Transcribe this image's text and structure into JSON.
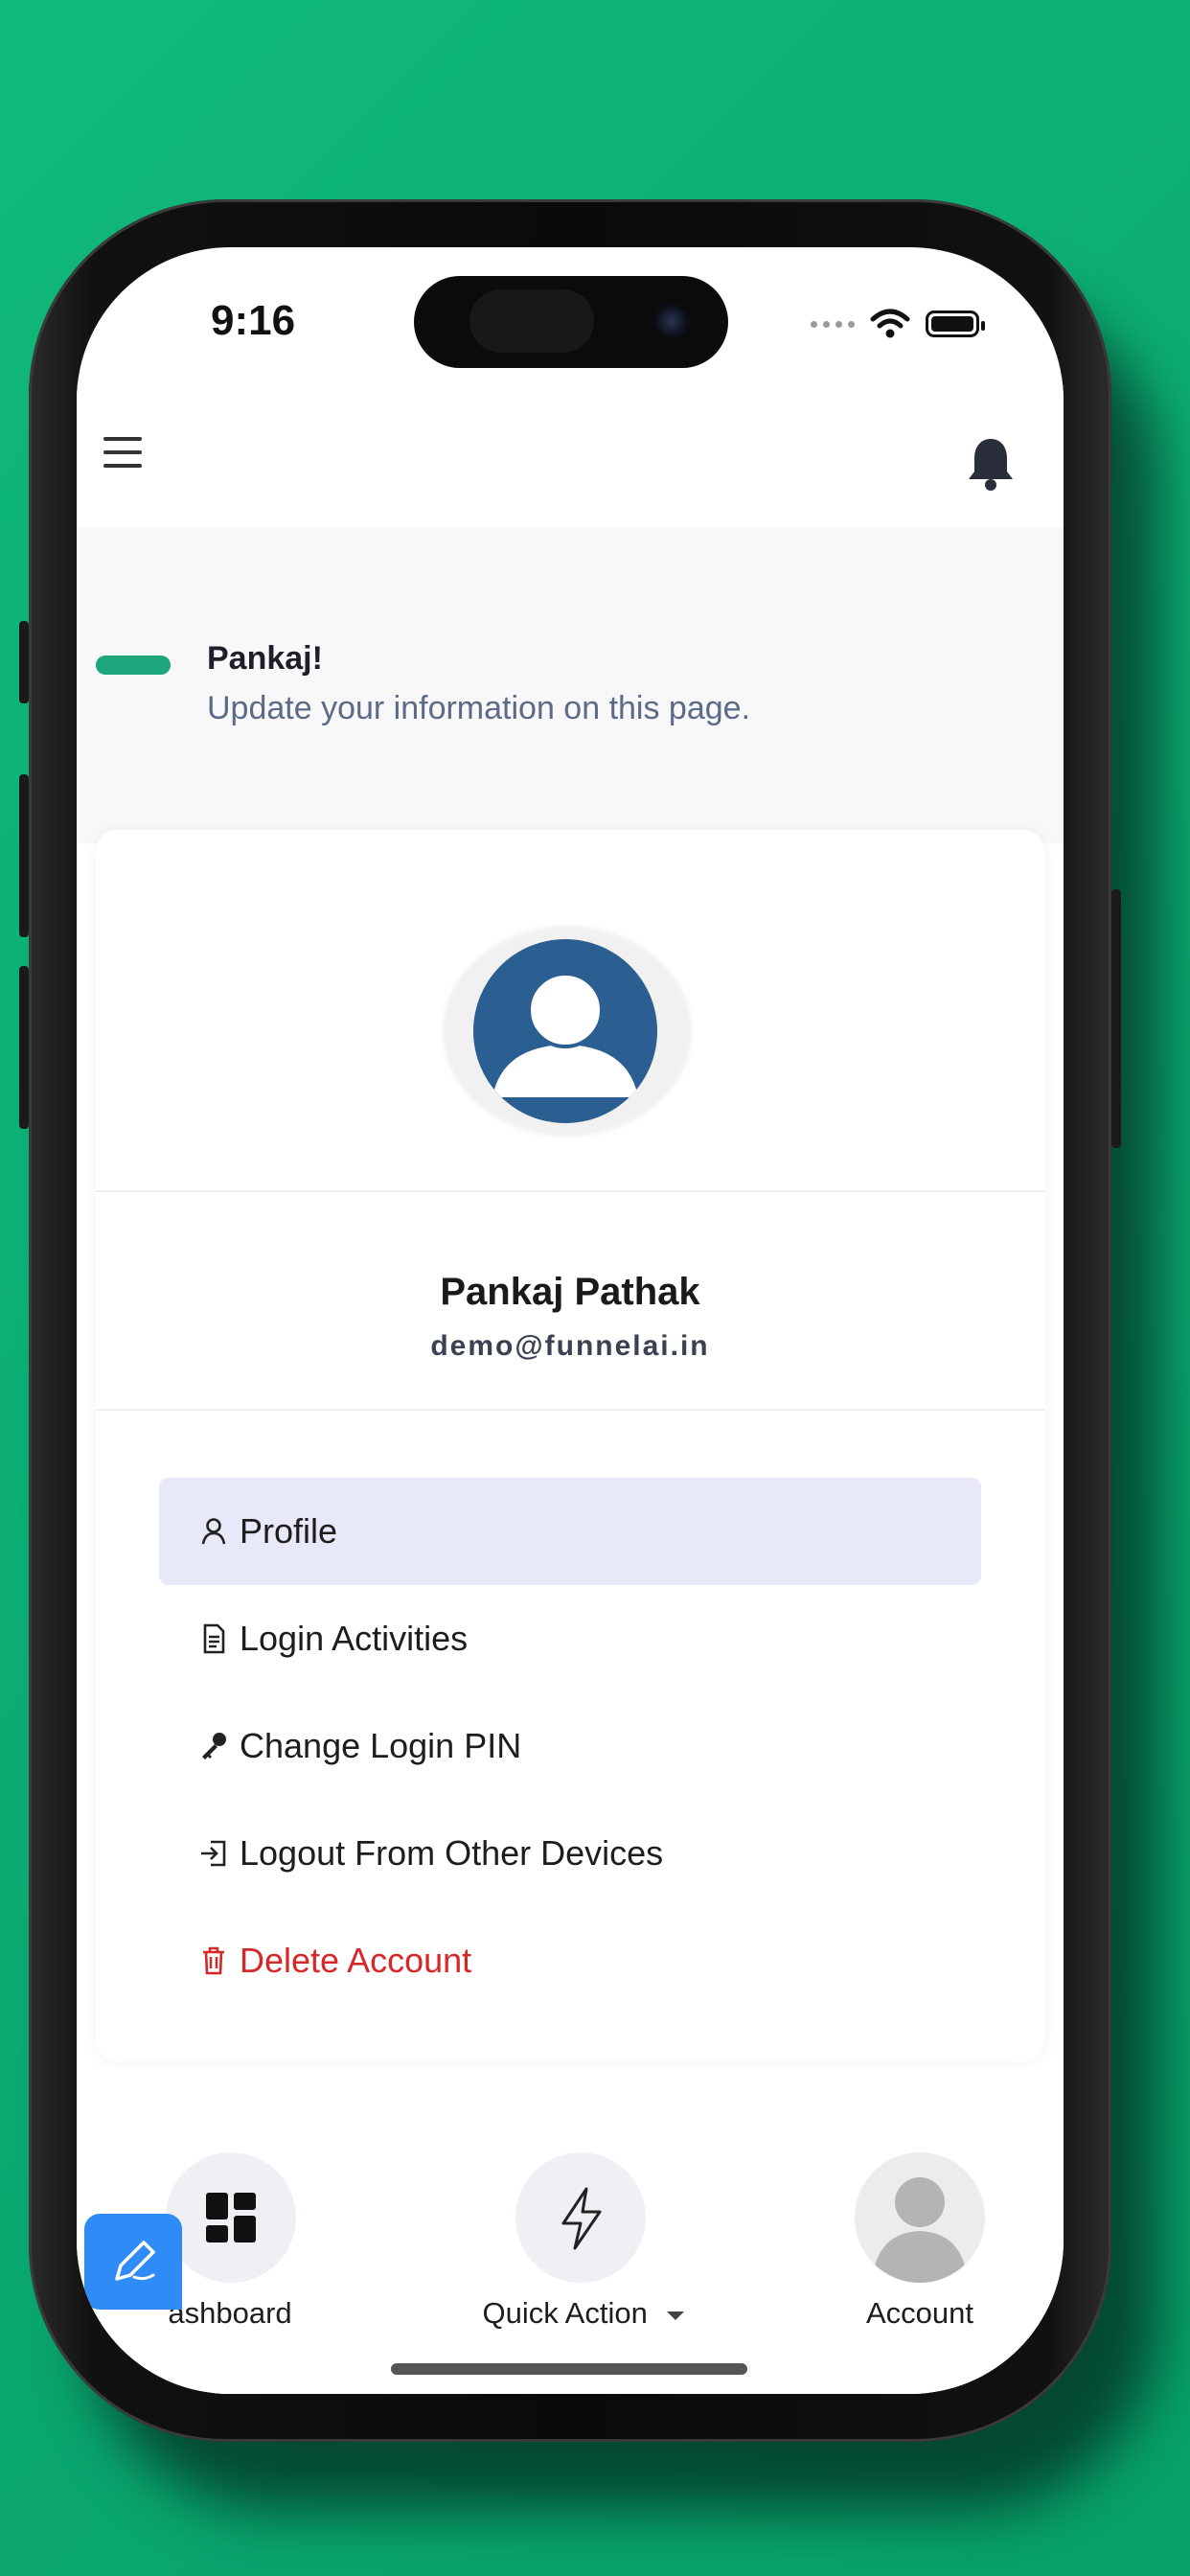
{
  "status_bar": {
    "time": "9:16",
    "icons": [
      "signal-dots-icon",
      "wifi-icon",
      "battery-icon"
    ]
  },
  "header": {
    "menu_icon": "hamburger-icon",
    "notification_icon": "bell-icon"
  },
  "greeting": {
    "name": "Pankaj!",
    "subtitle": "Update your information on this page."
  },
  "profile": {
    "avatar_icon": "user-avatar-icon",
    "name": "Pankaj Pathak",
    "email": "demo@funnelai.in"
  },
  "menu": {
    "items": [
      {
        "label": "Profile",
        "icon": "user-icon",
        "active": true
      },
      {
        "label": "Login Activities",
        "icon": "document-icon",
        "active": false
      },
      {
        "label": "Change Login PIN",
        "icon": "key-icon",
        "active": false
      },
      {
        "label": "Logout From Other Devices",
        "icon": "logout-icon",
        "active": false
      },
      {
        "label": "Delete Account",
        "icon": "trash-icon",
        "active": false,
        "danger": true
      }
    ]
  },
  "bottom_nav": {
    "dashboard_label": "ashboard",
    "quick_action_label": "Quick Action",
    "account_label": "Account"
  },
  "colors": {
    "background": "#0fb378",
    "accent": "#1da57c",
    "active_item": "#e7e9f8",
    "danger": "#d62828",
    "avatar": "#2c5f91",
    "fab": "#2f8bf5"
  }
}
